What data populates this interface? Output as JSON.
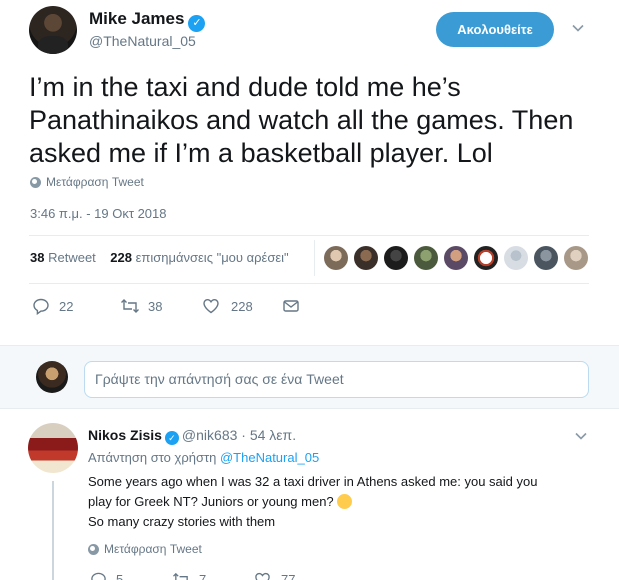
{
  "author": {
    "name": "Mike James",
    "handle": "@TheNatural_05",
    "follow_label": "Ακολουθείτε"
  },
  "tweet": {
    "text": "I’m in the taxi and dude told me he’s Panathinaikos and watch all the games. Then asked me if I’m a basketball player. Lol",
    "translate_label": "Μετάφραση Tweet",
    "timestamp": "3:46 π.μ. - 19 Οκτ 2018"
  },
  "stats": {
    "retweets_count": "38",
    "retweets_label": "Retweet",
    "likes_count": "228",
    "likes_label": "επισημάνσεις \"μου αρέσει\""
  },
  "likers": [
    {
      "color": "#7d6b5a"
    },
    {
      "color": "#3b2f2a"
    },
    {
      "color": "#1c1c1c"
    },
    {
      "color": "#4b5a3c"
    },
    {
      "color": "#5b4a66"
    },
    {
      "color": "#b8402a"
    },
    {
      "color": "#d7dde3"
    },
    {
      "color": "#4a5560"
    },
    {
      "color": "#a89888"
    }
  ],
  "actions": {
    "replies": "22",
    "retweets": "38",
    "likes": "228"
  },
  "reply_box": {
    "placeholder": "Γράψτε την απάντησή σας σε ένα Tweet"
  },
  "reply": {
    "name": "Nikos Zisis",
    "handle": "@nik683",
    "time": "54 λεπ.",
    "replying_prefix": "Απάντηση στο χρήστη",
    "replying_to": "@TheNatural_05",
    "line1": "Some years ago when I was 32 a taxi driver in Athens asked me: you said you",
    "line2": "play for Greek NT? Juniors or young men?",
    "line3": "So many crazy stories with them",
    "translate_label": "Μετάφραση Tweet",
    "actions": {
      "replies": "5",
      "retweets": "7",
      "likes": "77"
    }
  },
  "colors": {
    "accent": "#1da1f2",
    "follow_button": "#3a9bd5",
    "muted_text": "#657786"
  }
}
